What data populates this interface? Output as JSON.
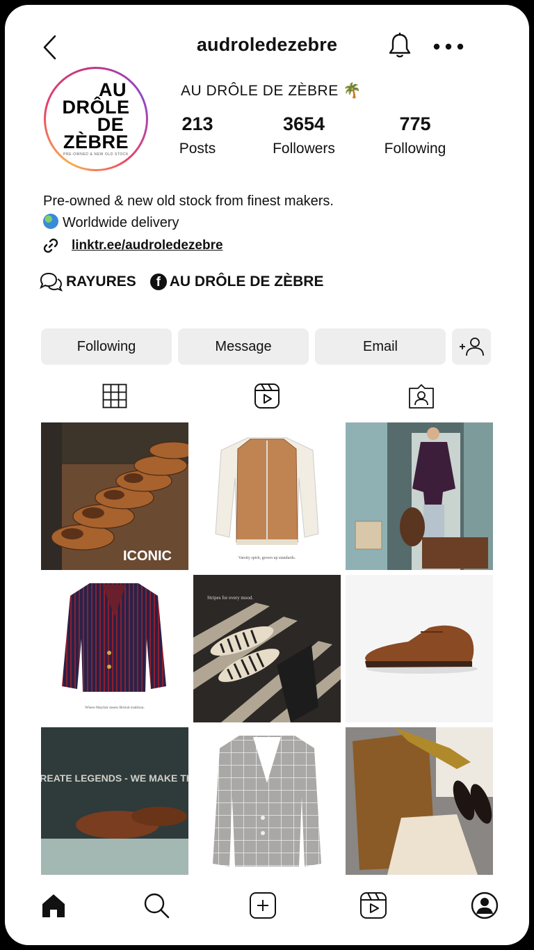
{
  "header": {
    "username": "audroledezebre"
  },
  "profile": {
    "logo_lines": [
      "AU",
      "DRÔLE",
      "DE",
      "ZÈBRE"
    ],
    "logo_tagline": "PRE-OWNED & NEW OLD STOCK",
    "display_name": "AU DRÔLE DE ZÈBRE",
    "display_name_emoji": "🌴",
    "stats": {
      "posts": {
        "value": "213",
        "label": "Posts"
      },
      "followers": {
        "value": "3654",
        "label": "Followers"
      },
      "following": {
        "value": "775",
        "label": "Following"
      }
    },
    "bio_line1": "Pre-owned & new old stock from finest makers.",
    "bio_line2": "Worldwide delivery",
    "link": "linktr.ee/audroledezebre",
    "tag1": "RAYURES",
    "tag2": "AU DRÔLE DE ZÈBRE"
  },
  "actions": {
    "following": "Following",
    "message": "Message",
    "email": "Email"
  },
  "tabs": [
    "grid-icon",
    "reels-icon",
    "tagged-icon"
  ],
  "posts": [
    {
      "subject": "brown brogue shoes",
      "caption": "ICONIC"
    },
    {
      "subject": "tan leather bomber jacket",
      "caption": "Varsity spirit, grown up standards."
    },
    {
      "subject": "man in striped blazer with luggage",
      "caption": ""
    },
    {
      "subject": "striped purple blazer",
      "caption": "Where Mayfair meets British tradition."
    },
    {
      "subject": "striped espadrilles in sunlight",
      "caption": "Stripes for every mood."
    },
    {
      "subject": "brown derby shoe",
      "caption": ""
    },
    {
      "subject": "brown loafers poster",
      "caption": "WE DON'T CREATE LEGENDS - WE MAKE THEM YOURS."
    },
    {
      "subject": "grey check blazer",
      "caption": ""
    },
    {
      "subject": "brown jacket flat lay",
      "caption": ""
    }
  ],
  "bottom_nav": [
    "home-icon",
    "search-icon",
    "create-icon",
    "reels-icon",
    "profile-icon"
  ]
}
